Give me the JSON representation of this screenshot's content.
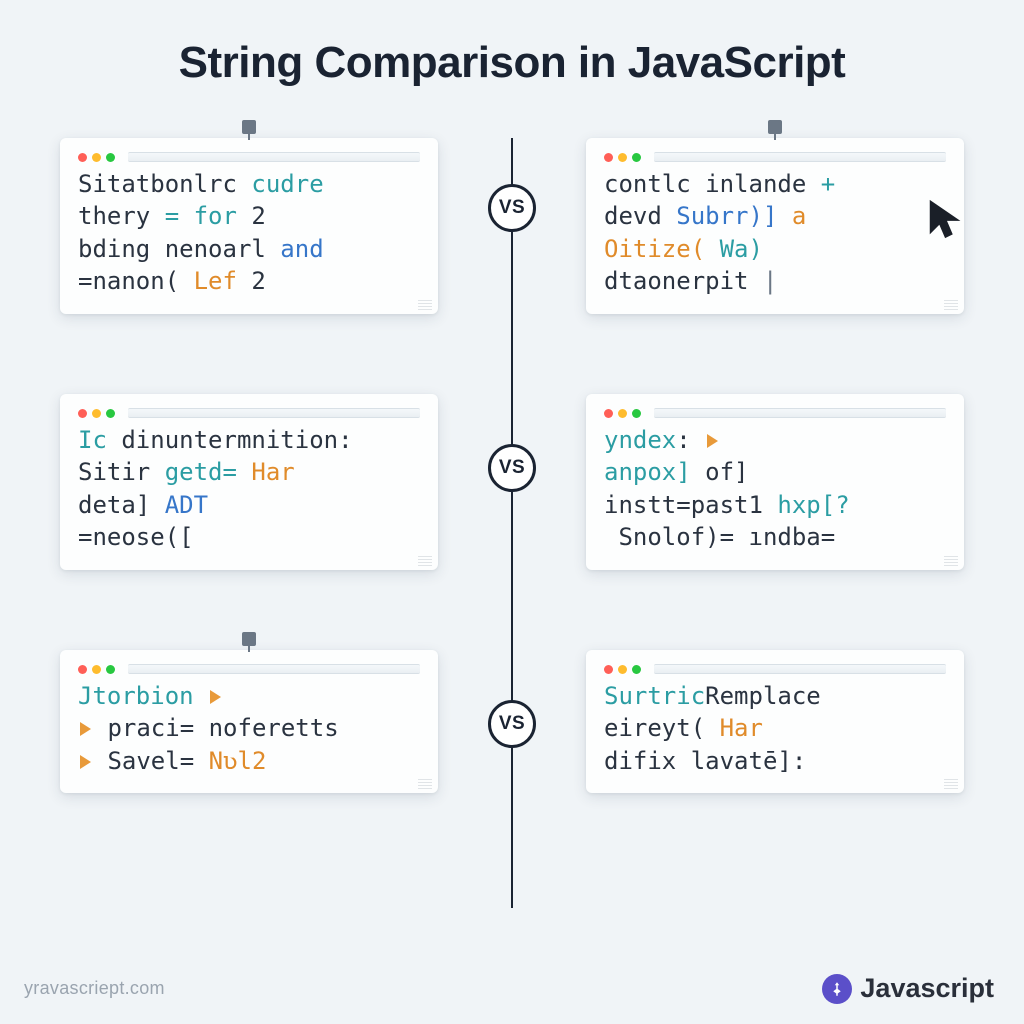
{
  "title": "String Comparison in JavaScript",
  "vs_label": "VS",
  "rows": [
    {
      "left": {
        "l1a": "Sitatbonlrc",
        "l1b": " cudre",
        "l2a": "thery ",
        "l2b": "= for",
        "l2c": " 2",
        "l3a": "bding nenoarl ",
        "l3b": "and",
        "l4a": "=nanon( ",
        "l4b": "Lef",
        "l4c": " 2"
      },
      "right": {
        "l1a": "contlc inlande ",
        "l1b": "+",
        "l2a": "devd ",
        "l2b": "Subrr)]",
        "l2c": " a",
        "l3a": "Oitize( ",
        "l3b": "Wa)",
        "l4a": "dtaonerpit ",
        "l4b": "|"
      }
    },
    {
      "left": {
        "l1a": "Ic",
        "l1b": " dinuntermnition:",
        "l2a": "Sitir ",
        "l2b": "getd= ",
        "l2c": "Har",
        "l3a": "deta] ",
        "l3b": "ADT",
        "l4a": "=neose([",
        "l4b": ""
      },
      "right": {
        "l1a": "yndex",
        "l1b": ":",
        "l2a": "anpox] ",
        "l2b": "of]",
        "l3a": "instt=past1 ",
        "l3b": "hxp[?",
        "l4a": " Snolof)",
        "l4b": "= ındba="
      }
    },
    {
      "left": {
        "l1a": "Jtorbion",
        "l2a": " praci= ",
        "l2b": "noferetts",
        "l3a": " Savel= ",
        "l3b": "Nʋl2"
      },
      "right": {
        "l1a": "Surtric",
        "l1b": "Remplace",
        "l2a": "eireyt( ",
        "l2b": "Har",
        "l3a": "difix ",
        "l3b": "lavatē]:"
      }
    }
  ],
  "footer": {
    "left": "yravascriept.com",
    "right": "Javascript"
  }
}
